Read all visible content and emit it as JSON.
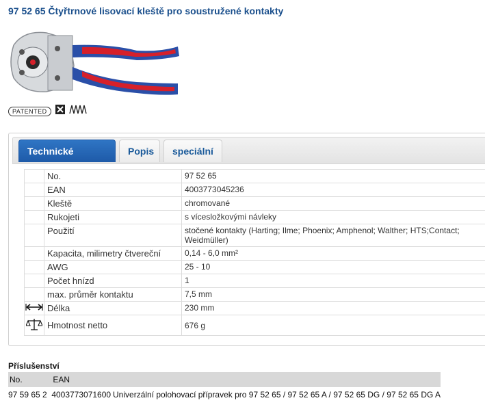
{
  "page_title": "97 52 65 Čtyřtrnové lisovací kleště pro soustružené kontakty",
  "badges": {
    "patented_label": "PATENTED"
  },
  "tabs": [
    {
      "label": "Technické atributy",
      "active": true
    },
    {
      "label": "Popis",
      "active": false
    },
    {
      "label": "speciální",
      "active": false
    }
  ],
  "attributes": [
    {
      "name": "No.",
      "value": "97 52 65"
    },
    {
      "name": "EAN",
      "value": "4003773045236"
    },
    {
      "name": "Kleště",
      "value": "chromované"
    },
    {
      "name": "Rukojeti",
      "value": "s vícesložkovými návleky"
    },
    {
      "name": "Použití",
      "value": "stočené kontakty (Harting; Ilme; Phoenix; Amphenol; Walther; HTS;Contact; Weidmüller)"
    },
    {
      "name": "Kapacita, milimetry čtvereční",
      "value": "0,14 - 6,0 mm²"
    },
    {
      "name": "AWG",
      "value": "25 - 10"
    },
    {
      "name": "Počet hnízd",
      "value": "1"
    },
    {
      "name": "max. průměr kontaktu",
      "value": "7,5 mm"
    },
    {
      "name": "Délka",
      "value": "230 mm",
      "icon": "length-arrows-icon"
    },
    {
      "name": "Hmotnost netto",
      "value": "676 g",
      "icon": "scale-icon"
    }
  ],
  "accessories": {
    "title": "Příslušenství",
    "columns": [
      "No.",
      "EAN",
      ""
    ],
    "rows": [
      {
        "no": "97 59 65 2",
        "ean": "4003773071600",
        "desc": "Univerzální polohovací přípravek pro 97 52 65 / 97 52 65 A / 97 52 65 DG / 97 52 65 DG A"
      }
    ]
  },
  "colors": {
    "brand_blue": "#1a4f8c",
    "tab_active": "#1e5aa8",
    "grip_red": "#d6202a",
    "grip_blue": "#2a4fa8"
  }
}
